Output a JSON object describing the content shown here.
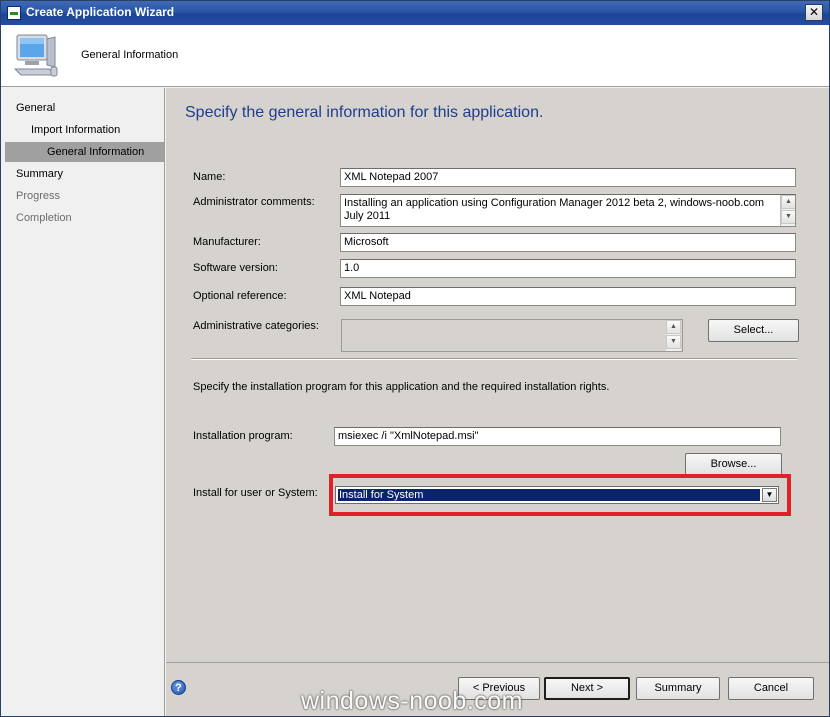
{
  "window": {
    "title": "Create Application Wizard",
    "close_glyph": "✕"
  },
  "header": {
    "title": "General Information"
  },
  "sidebar": {
    "items": [
      {
        "label": "General"
      },
      {
        "label": "Import Information"
      },
      {
        "label": "General Information",
        "selected": true
      },
      {
        "label": "Summary"
      },
      {
        "label": "Progress",
        "disabled": true
      },
      {
        "label": "Completion",
        "disabled": true
      }
    ]
  },
  "content": {
    "heading": "Specify the general information for this application.",
    "fields": {
      "name": {
        "label": "Name:",
        "value": "XML Notepad 2007"
      },
      "admin_comments": {
        "label": "Administrator comments:",
        "value": "Installing an application using Configuration Manager 2012 beta 2, windows-noob.com July 2011"
      },
      "manufacturer": {
        "label": "Manufacturer:",
        "value": "Microsoft"
      },
      "software_version": {
        "label": "Software version:",
        "value": "1.0"
      },
      "optional_reference": {
        "label": "Optional reference:",
        "value": "XML Notepad"
      },
      "admin_categories": {
        "label": "Administrative categories:",
        "value": ""
      }
    },
    "select_button": "Select...",
    "install_instructions": "Specify the installation program for this application and the required installation rights.",
    "installation_program": {
      "label": "Installation program:",
      "value": "msiexec /i \"XmlNotepad.msi\""
    },
    "browse_button": "Browse...",
    "install_for": {
      "label": "Install for user or System:",
      "selected": "Install for System"
    }
  },
  "footer": {
    "help_glyph": "?",
    "previous": "< Previous",
    "next": "Next >",
    "summary": "Summary",
    "cancel": "Cancel"
  },
  "watermark": "windows-noob.com",
  "colors": {
    "heading": "#1f3d8f",
    "highlight_border": "#e0202a",
    "selection": "#0a246a",
    "titlebar": "#2a55a8"
  }
}
